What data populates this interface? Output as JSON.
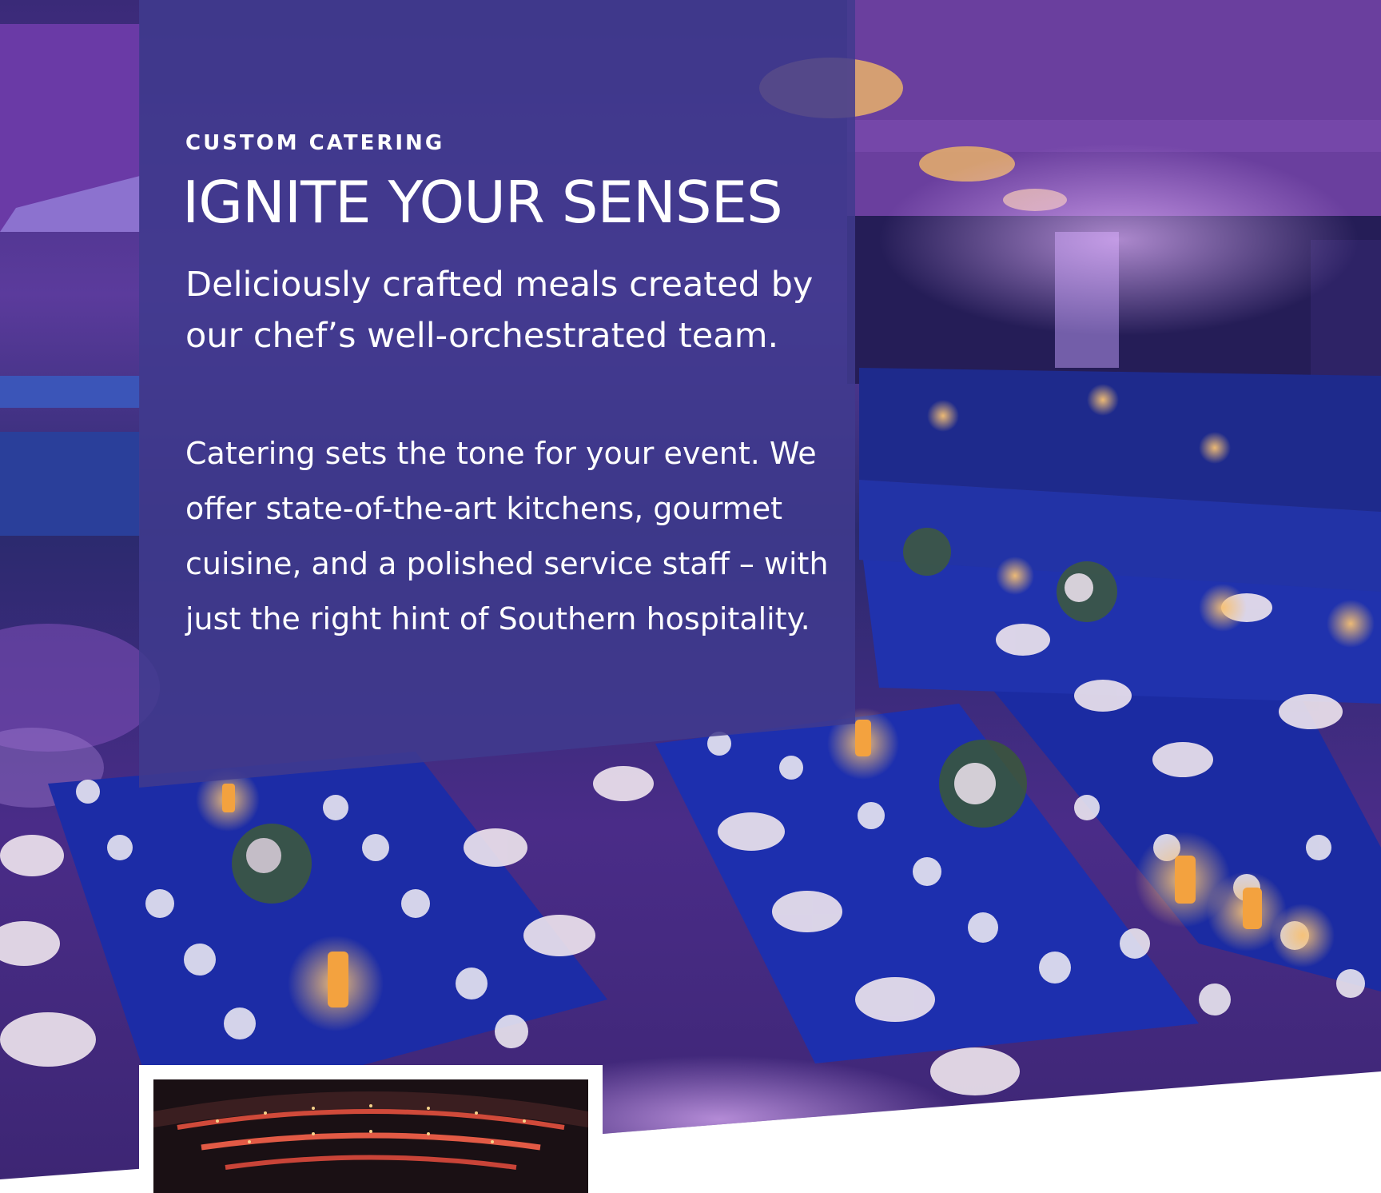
{
  "panel": {
    "eyebrow": "CUSTOM CATERING",
    "headline": "IGNITE YOUR SENSES",
    "lede": "Deliciously crafted meals created by our chef’s well-orchestrated team.",
    "body": "Catering sets the tone for your event. We offer state-of-the-art kitchens, gourmet cuisine, and a polished service staff – with just the right hint of Southern hospitality."
  },
  "images": {
    "main_photo": "banquet-ballroom-photo",
    "inset_photo": "theater-interior-photo"
  },
  "colors": {
    "panel": "#403a8e",
    "photo_purple": "#5a2f8c",
    "tablecloth_blue": "#1f2fa8",
    "candle_glow": "#f4a640"
  }
}
